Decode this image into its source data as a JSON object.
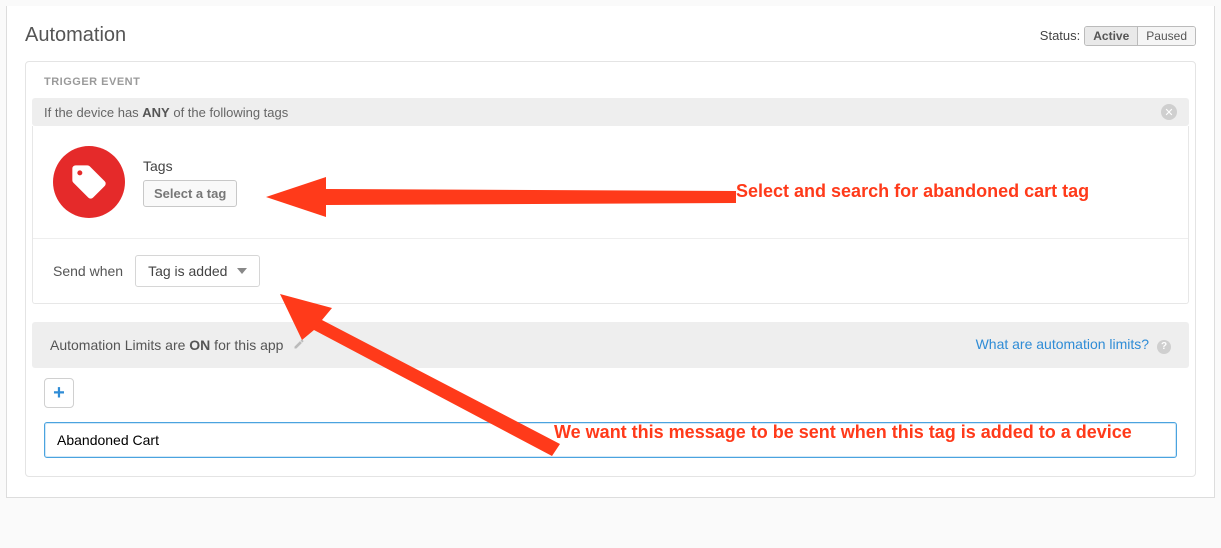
{
  "header": {
    "title": "Automation",
    "status_label": "Status:",
    "active_label": "Active",
    "paused_label": "Paused"
  },
  "trigger": {
    "section_title": "TRIGGER EVENT",
    "condition_pre": "If the device has ",
    "condition_bold": "ANY",
    "condition_post": " of the following tags",
    "tags_label": "Tags",
    "select_tag_label": "Select a tag",
    "send_when_label": "Send when",
    "send_when_value": "Tag is added"
  },
  "limits": {
    "pre": "Automation Limits are ",
    "bold": "ON",
    "post": " for this app",
    "link": "What are automation limits?"
  },
  "input": {
    "value": "Abandoned Cart"
  },
  "annotations": {
    "a1": "Select and search for abandoned cart tag",
    "a2": "We want this message to be sent when this tag is added to a device"
  }
}
